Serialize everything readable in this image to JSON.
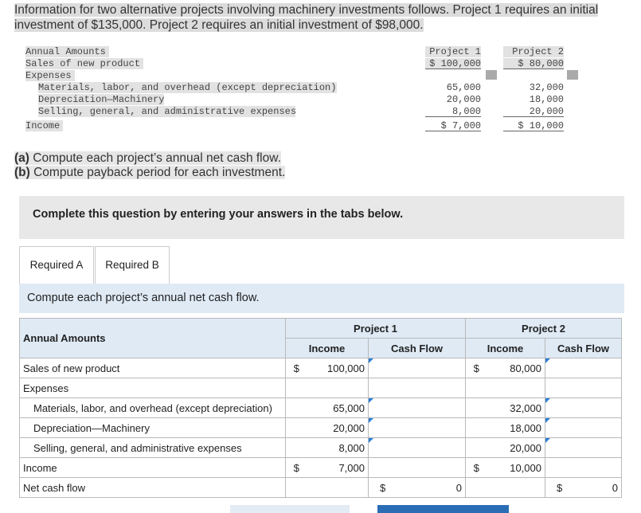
{
  "intro": {
    "line1": "Information for two alternative projects involving machinery investments follows. Project 1 requires an initial",
    "line2": "investment of $135,000. Project 2 requires an initial investment of $98,000."
  },
  "given": {
    "header_label": "Annual Amounts",
    "project1_header": "Project 1",
    "project2_header": "Project 2",
    "rows": [
      {
        "label": "Sales of new product",
        "p1": "$ 100,000",
        "p2": "$ 80,000"
      },
      {
        "label": "Expenses",
        "p1": "",
        "p2": ""
      },
      {
        "label": "Materials, labor, and overhead (except depreciation)",
        "p1": "65,000",
        "p2": "32,000"
      },
      {
        "label": "Depreciation—Machinery",
        "p1": "20,000",
        "p2": "18,000"
      },
      {
        "label": "Selling, general, and administrative expenses",
        "p1": "8,000",
        "p2": "20,000"
      },
      {
        "label": "Income",
        "p1": "$ 7,000",
        "p2": "$ 10,000"
      }
    ]
  },
  "questions": {
    "a_tag": "(a)",
    "a_text": " Compute each project’s annual net cash flow.",
    "b_tag": "(b)",
    "b_text": " Compute payback period for each investment."
  },
  "banner": "Complete this question by entering your answers in the tabs below.",
  "tabs": [
    "Required A",
    "Required B"
  ],
  "instruction": "Compute each project’s annual net cash flow.",
  "table": {
    "corner": "Annual Amounts",
    "project1": "Project 1",
    "project2": "Project 2",
    "sub_income": "Income",
    "sub_cashflow": "Cash Flow",
    "dollar": "$",
    "rows": {
      "sales": {
        "label": "Sales of new product",
        "p1_income": "100,000",
        "p2_income": "80,000"
      },
      "expenses": {
        "label": "Expenses"
      },
      "materials": {
        "label": "Materials, labor, and overhead (except depreciation)",
        "p1_income": "65,000",
        "p2_income": "32,000"
      },
      "depreciation": {
        "label": "Depreciation—Machinery",
        "p1_income": "20,000",
        "p2_income": "18,000"
      },
      "selling": {
        "label": "Selling, general, and administrative expenses",
        "p1_income": "8,000",
        "p2_income": "20,000"
      },
      "income": {
        "label": "Income",
        "p1_income": "7,000",
        "p2_income": "10,000"
      },
      "net": {
        "label": "Net cash flow",
        "p1_cashflow": "0",
        "p2_cashflow": "0"
      }
    }
  },
  "colors": {
    "accent": "#2a7fd6",
    "header_bg": "#dfeaf5",
    "banner_bg": "#e8e8e8",
    "next_button": "#2a6db5"
  }
}
